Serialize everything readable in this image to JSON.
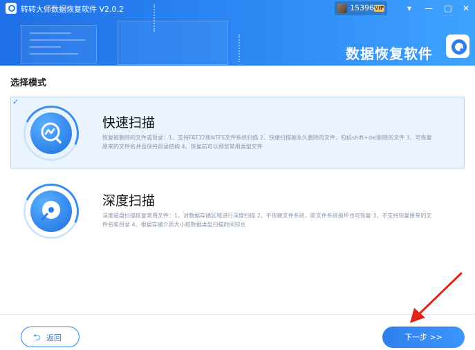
{
  "app": {
    "title": "转转大师数据恢复软件 V2.0.2",
    "brand_text": "数据恢复软件"
  },
  "user": {
    "name": "15396...",
    "badge": "VIP"
  },
  "window_controls": {
    "dropdown": "▾",
    "minimize": "—",
    "maximize": "□",
    "close": "✕"
  },
  "main": {
    "section_title": "选择模式",
    "modes": [
      {
        "title": "快速扫描",
        "description": "恢复被删除的文件或目录：1、支持FAT32和NTFS文件系统扫描 2、快速扫描被永久删除的文件，包括shift+del删除的文件 3、可恢复原来的文件名并且保持目录结构 4、恢复前可以预览常用类型文件",
        "selected": true,
        "check": "✓",
        "icon": "quick-scan-icon"
      },
      {
        "title": "深度扫描",
        "description": "深度磁盘扫描恢复常用文件：1、对数据存储区域进行深度扫描 2、不依赖文件系统，即文件系统损坏也可恢复 3、不支持恢复原来的文件名和目录 4、根据存储介质大小和数据类型扫描时间较长",
        "selected": false,
        "icon": "deep-scan-icon"
      }
    ]
  },
  "footer": {
    "back_label": "返回",
    "next_label": "下一步 >>"
  },
  "colors": {
    "accent": "#2d7ff0",
    "selected_bg": "#eaf4fe",
    "annotation_arrow": "#e0261b"
  }
}
